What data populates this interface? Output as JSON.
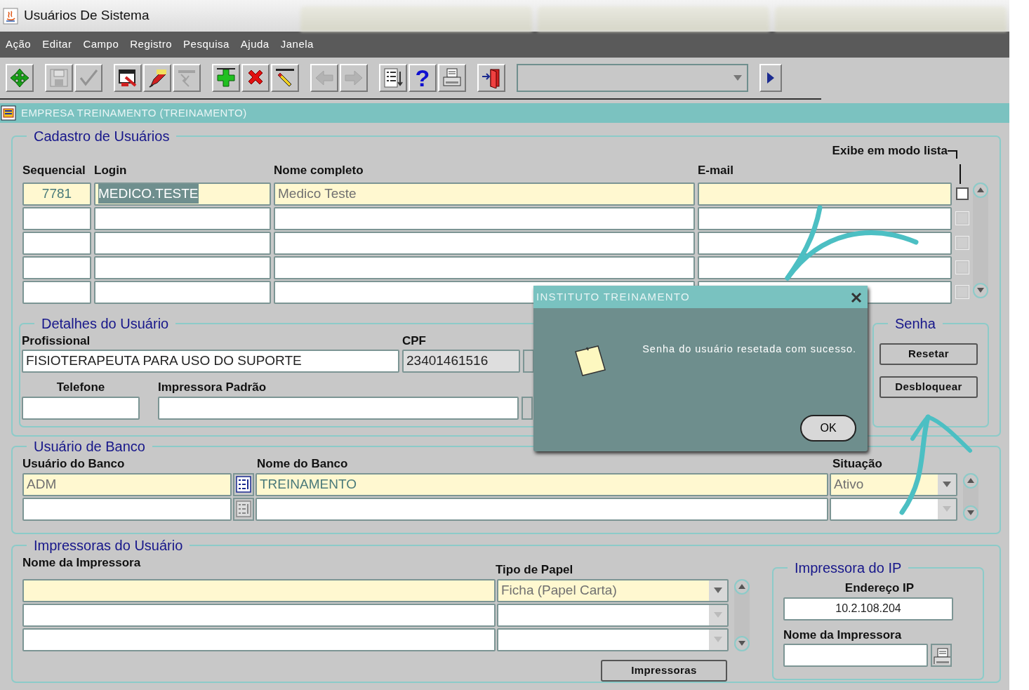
{
  "window": {
    "title": "Usuários De Sistema"
  },
  "menu": [
    "Ação",
    "Editar",
    "Campo",
    "Registro",
    "Pesquisa",
    "Ajuda",
    "Janela"
  ],
  "toolbar": [
    [
      {
        "kind": "move",
        "disabled": false
      }
    ],
    [
      {
        "kind": "save",
        "disabled": true
      },
      {
        "kind": "check",
        "disabled": true
      }
    ],
    [
      {
        "kind": "window",
        "disabled": false
      },
      {
        "kind": "pen",
        "disabled": false
      },
      {
        "kind": "clear",
        "disabled": true
      }
    ],
    [
      {
        "kind": "add",
        "disabled": false
      },
      {
        "kind": "delete",
        "disabled": false
      },
      {
        "kind": "eraser",
        "disabled": false
      }
    ],
    [
      {
        "kind": "prev",
        "disabled": true
      },
      {
        "kind": "next",
        "disabled": true
      }
    ],
    [
      {
        "kind": "list",
        "disabled": false
      },
      {
        "kind": "help",
        "disabled": false,
        "glyph": "?"
      },
      {
        "kind": "print",
        "disabled": false
      }
    ],
    [
      {
        "kind": "exit",
        "disabled": false
      }
    ]
  ],
  "form_title": "EMPRESA TREINAMENTO (TREINAMENTO)",
  "cadastro": {
    "title": "Cadastro de Usuários",
    "list_mode_label": "Exibe em modo lista",
    "columns": [
      "Sequencial",
      "Login",
      "Nome completo",
      "E-mail"
    ],
    "rows": [
      {
        "sequencial": "7781",
        "login": "MEDICO.TESTE",
        "nome": "Medico Teste",
        "current": true,
        "login_highlighted": true,
        "list_mode": false,
        "disabled": false
      },
      {
        "current": false,
        "login_highlighted": false,
        "list_mode": false,
        "disabled": true
      },
      {
        "current": false,
        "login_highlighted": false,
        "list_mode": false,
        "disabled": true
      },
      {
        "current": false,
        "login_highlighted": false,
        "list_mode": false,
        "disabled": true
      },
      {
        "current": false,
        "login_highlighted": false,
        "list_mode": false,
        "disabled": true
      }
    ]
  },
  "detalhes": {
    "title": "Detalhes do Usuário",
    "profissional": {
      "label": "Profissional",
      "value": "FISIOTERAPEUTA PARA USO DO SUPORTE"
    },
    "cpf": {
      "label": "CPF",
      "value": "23401461516"
    },
    "telefone": {
      "label": "Telefone"
    },
    "impressora": {
      "label": "Impressora Padrão"
    }
  },
  "senha": {
    "title": "Senha",
    "buttons": [
      "Resetar",
      "Desbloquear"
    ]
  },
  "banco": {
    "title": "Usuário de Banco",
    "columns": [
      "Usuário do Banco",
      "Nome do Banco",
      "Situação"
    ],
    "rows": [
      {
        "usuario": "ADM",
        "banco": "TREINAMENTO",
        "situacao": "Ativo",
        "current": true
      },
      {
        "current": false
      }
    ]
  },
  "impressoras": {
    "title": "Impressoras do Usuário",
    "columns": [
      "Nome da Impressora",
      "Tipo de Papel"
    ],
    "rows": [
      {
        "tipo": "Ficha (Papel Carta)",
        "current": true
      },
      {
        "current": false
      },
      {
        "current": false
      }
    ],
    "button": "Impressoras"
  },
  "impressora_ip": {
    "title": "Impressora do IP",
    "ip_label": "Endereço IP",
    "ip_value": "10.2.108.204",
    "name_label": "Nome da Impressora"
  },
  "dialog": {
    "title": "INSTITUTO TREINAMENTO",
    "message": "Senha do usuário resetada com sucesso.",
    "ok": "OK"
  }
}
